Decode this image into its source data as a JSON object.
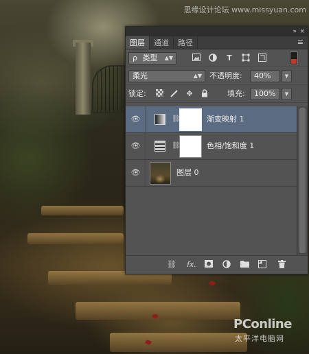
{
  "watermark_top": "思缘设计论坛 www.missyuan.com",
  "pconline": {
    "brand": "PConline",
    "sub": "太平洋电脑网"
  },
  "panel": {
    "controls": {
      "collapse": "»",
      "close": "×"
    },
    "tabs": [
      {
        "label": "图层",
        "active": true
      },
      {
        "label": "通道",
        "active": false
      },
      {
        "label": "路径",
        "active": false
      }
    ],
    "menu_icon": "≡",
    "filter": {
      "search_icon": "ρ",
      "kind_label": "类型",
      "icons": [
        "image-filter-icon",
        "adjustment-filter-icon",
        "type-filter-icon",
        "shape-filter-icon",
        "smart-object-filter-icon"
      ],
      "toggle": "filter-toggle"
    },
    "blend": {
      "mode": "柔光",
      "opacity_label": "不透明度:",
      "opacity_value": "40%"
    },
    "lock": {
      "label": "锁定:",
      "fill_label": "填充:",
      "fill_value": "100%"
    },
    "layers": [
      {
        "name": "渐变映射 1",
        "type": "gradient-map",
        "selected": true
      },
      {
        "name": "色相/饱和度 1",
        "type": "hue-saturation",
        "selected": false
      },
      {
        "name": "图层 0",
        "type": "image",
        "selected": false
      }
    ],
    "bottom_icons": [
      "link-layers-icon",
      "fx-icon",
      "add-mask-icon",
      "new-adjustment-icon",
      "new-group-icon",
      "new-layer-icon",
      "delete-layer-icon"
    ],
    "fx_label": "fx."
  }
}
